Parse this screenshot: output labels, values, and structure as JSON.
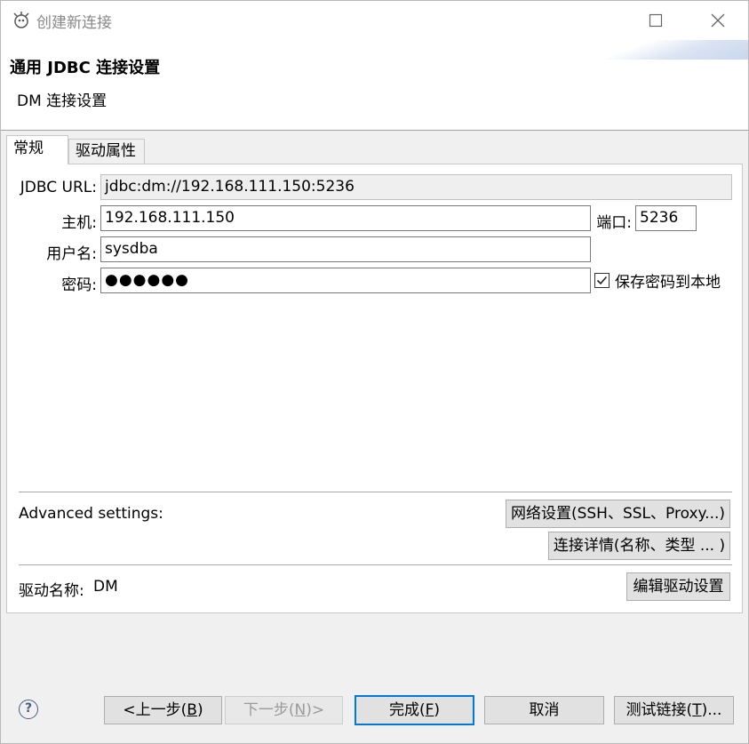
{
  "window": {
    "title": "创建新连接",
    "minimize_icon": "minimize-icon",
    "maximize_icon": "maximize-icon",
    "close_icon": "close-icon"
  },
  "header": {
    "title": "通用 JDBC 连接设置",
    "subtitle": "DM 连接设置"
  },
  "tabs": [
    {
      "label": "常规",
      "active": true
    },
    {
      "label": "驱动属性",
      "active": false
    }
  ],
  "form": {
    "jdbc_url_label": "JDBC URL:",
    "jdbc_url_value": "jdbc:dm://192.168.111.150:5236",
    "host_label": "主机:",
    "host_value": "192.168.111.150",
    "port_label": "端口:",
    "port_value": "5236",
    "username_label": "用户名:",
    "username_value": "sysdba",
    "password_label": "密码:",
    "password_mask": "●●●●●●",
    "save_password_label": "保存密码到本地",
    "save_password_checked": true
  },
  "advanced": {
    "label": "Advanced settings:",
    "network_button": "网络设置(SSH、SSL、Proxy...)",
    "details_button": "连接详情(名称、类型 ... )"
  },
  "driver": {
    "label": "驱动名称:",
    "name": "DM",
    "edit_button": "编辑驱动设置"
  },
  "footer": {
    "help_icon": "help-icon",
    "back_button": {
      "text": "<上一步(",
      "key": "B",
      "suffix": ")"
    },
    "next_button": {
      "text": "下一步(",
      "key": "N",
      "suffix": ")>"
    },
    "finish_button": {
      "text": "完成(",
      "key": "F",
      "suffix": ")"
    },
    "cancel_button": "取消",
    "test_button": {
      "text": "测试链接(",
      "key": "T",
      "suffix": ")..."
    }
  },
  "colors": {
    "accent": "#0078d7",
    "background": "#f0f0f0"
  }
}
